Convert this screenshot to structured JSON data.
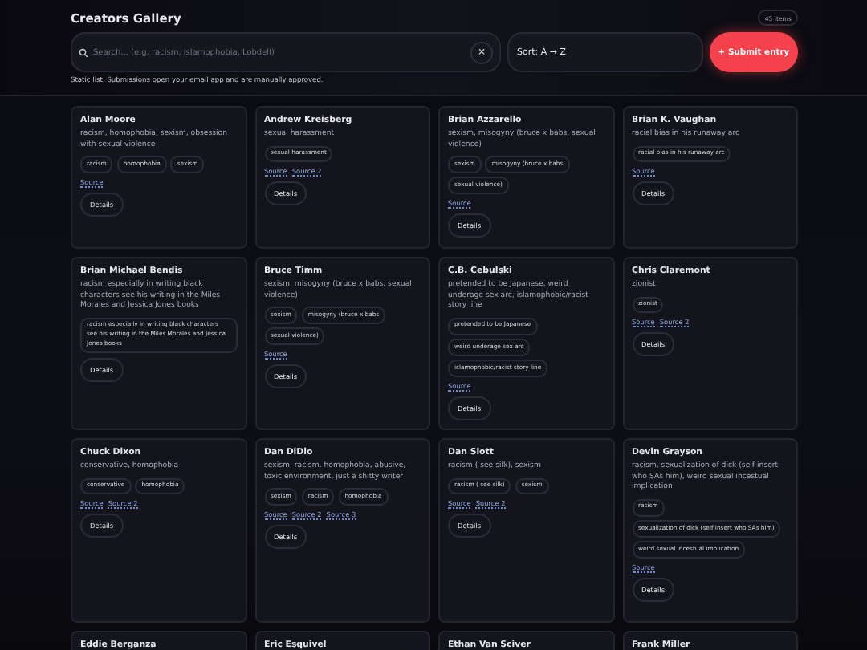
{
  "header": {
    "title": "Creators Gallery",
    "count": "45 items",
    "search": {
      "placeholder": "Search... (e.g. racism, islamophobia, Lobdell)",
      "clear": "×"
    },
    "sort": "Sort: A → Z",
    "submit": "+ Submit entry",
    "note": "Static list. Submissions open your email app and are manually approved."
  },
  "cards": [
    {
      "name": "Alan Moore",
      "description": "racism, homophobia, sexism, obsession with sexual violence",
      "tags": [
        "racism",
        "homophobia",
        "sexism"
      ],
      "sources": [
        "Source"
      ],
      "button": "Details"
    },
    {
      "name": "Andrew Kreisberg",
      "description": "sexual harassment",
      "tags": [
        "sexual harassment"
      ],
      "sources": [
        "Source",
        "Source 2"
      ],
      "button": "Details"
    },
    {
      "name": "Brian Azzarello",
      "description": "sexism, misogyny (bruce x babs, sexual violence)",
      "tags": [
        "sexism",
        "misogyny (bruce x babs",
        "sexual violence)"
      ],
      "sources": [
        "Source"
      ],
      "button": "Details"
    },
    {
      "name": "Brian K. Vaughan",
      "description": "racial bias in his runaway arc",
      "tags": [
        "racial bias in his runaway arc"
      ],
      "sources": [
        "Source"
      ],
      "button": "Details"
    },
    {
      "name": "Brian Michael Bendis",
      "description": "racism especially in writing black characters see his writing in the Miles Morales and Jessica Jones books",
      "tags": [
        "racism especially in writing black characters see his writing in the Miles Morales and Jessica Jones books"
      ],
      "button": "Details"
    },
    {
      "name": "Bruce Timm",
      "description": "sexism, misogyny (bruce x babs, sexual violence)",
      "tags": [
        "sexism",
        "misogyny (bruce x babs",
        "sexual violence)"
      ],
      "sources": [
        "Source"
      ],
      "button": "Details"
    },
    {
      "name": "C.B. Cebulski",
      "description": "pretended to be Japanese, weird underage sex arc, islamophobic/racist story line",
      "tags": [
        "pretended to be Japanese",
        "weird underage sex arc",
        "islamophobic/racist story line"
      ],
      "sources": [
        "Source"
      ],
      "button": "Details"
    },
    {
      "name": "Chris Claremont",
      "description": "zionist",
      "tags": [
        "zionist"
      ],
      "sources": [
        "Source",
        "Source 2"
      ],
      "button": "Details"
    },
    {
      "name": "Chuck Dixon",
      "description": "conservative, homophobia",
      "tags": [
        "conservative",
        "homophobia"
      ],
      "sources": [
        "Source",
        "Source 2"
      ],
      "button": "Details"
    },
    {
      "name": "Dan DiDio",
      "description": "sexism, racism, homophobia, abusive, toxic environment, just a shitty writer",
      "tags": [
        "sexism",
        "racism",
        "homophobia"
      ],
      "sources": [
        "Source",
        "Source 2",
        "Source 3"
      ],
      "button": "Details"
    },
    {
      "name": "Dan Slott",
      "description": "racism ( see silk), sexism",
      "tags": [
        "racism ( see silk)",
        "sexism"
      ],
      "sources": [
        "Source",
        "Source 2"
      ],
      "button": "Details"
    },
    {
      "name": "Devin Grayson",
      "description": "racism, sexualization of dick (self insert who SAs him), weird sexual incestual implication",
      "tags": [
        "racism",
        "sexualization of dick (self insert who SAs him)",
        "weird sexual incestual implication"
      ],
      "sources": [
        "Source"
      ],
      "button": "Details"
    },
    {
      "name": "Eddie Berganza"
    },
    {
      "name": "Eric Esquivel"
    },
    {
      "name": "Ethan Van Sciver"
    },
    {
      "name": "Frank Miller"
    }
  ]
}
